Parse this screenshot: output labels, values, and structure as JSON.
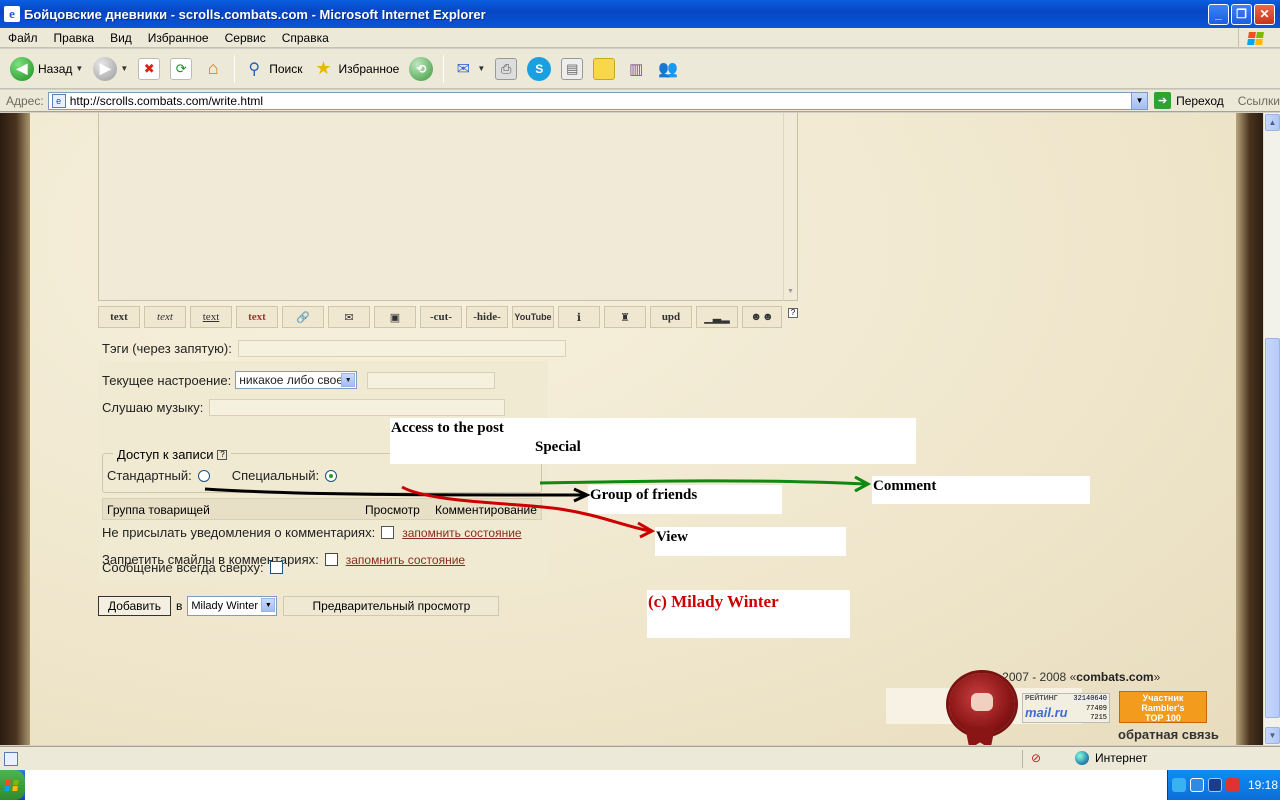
{
  "window": {
    "title": "Бойцовские дневники - scrolls.combats.com - Microsoft Internet Explorer",
    "minimize": "_",
    "maximize": "❐",
    "close": "✕"
  },
  "menu": [
    "Файл",
    "Правка",
    "Вид",
    "Избранное",
    "Сервис",
    "Справка"
  ],
  "toolbar": {
    "back": "Назад",
    "search": "Поиск",
    "favorites": "Избранное"
  },
  "address": {
    "label": "Адрес:",
    "url": "http://scrolls.combats.com/write.html",
    "go": "Переход",
    "links": "Ссылки"
  },
  "format_buttons": [
    "text",
    "text",
    "text",
    "text",
    "",
    "",
    "",
    "-cut-",
    "-hide-",
    "YouTube",
    "",
    "",
    "upd",
    "",
    ""
  ],
  "form": {
    "tags_label": "Тэги (через запятую):",
    "mood_label": "Текущее настроение:",
    "mood_value": "никакое либо свое",
    "music_label": "Слушаю музыку:",
    "access_legend": "Доступ к записи",
    "standard_label": "Стандартный:",
    "special_label": "Специальный:",
    "group_label": "Группа товарищей",
    "view_label": "Просмотр",
    "comment_label": "Комментирование",
    "no_notify_label": "Не присылать уведомления о комментариях:",
    "remember_state": "запомнить состояние",
    "no_smiles_label": "Запретить смайлы в комментариях:",
    "always_top_label": "Сообщение всегда сверху:",
    "add_button": "Добавить",
    "in_label": "в",
    "journal_value": "Milady Winter",
    "preview_button": "Предварительный просмотр"
  },
  "annotations": {
    "access": "Access to the post",
    "special": "Special",
    "group": "Group of friends",
    "comment": "Comment",
    "view": "View",
    "copyright": "(c) Milady Winter"
  },
  "footer": {
    "copyright_prefix": "© 2007 - 2008 «",
    "copyright_site": "combats.com",
    "copyright_suffix": "»",
    "feedback": "обратная связь",
    "mailru_label": "РЕЙТИНГ",
    "mailru_logo": "mail.ru",
    "mailru_n1": "32140640",
    "mailru_n2": "77409",
    "mailru_n3": "7215",
    "rambler_l1": "Участник",
    "rambler_l2": "Rambler's",
    "rambler_l3": "TOP 100"
  },
  "status": {
    "zone": "Интернет"
  },
  "taskbar": {
    "clock": "19:18"
  },
  "colors": {
    "annotation_red": "#cc0000",
    "arrow_green": "#118811",
    "parchment": "#f3ecd8"
  }
}
